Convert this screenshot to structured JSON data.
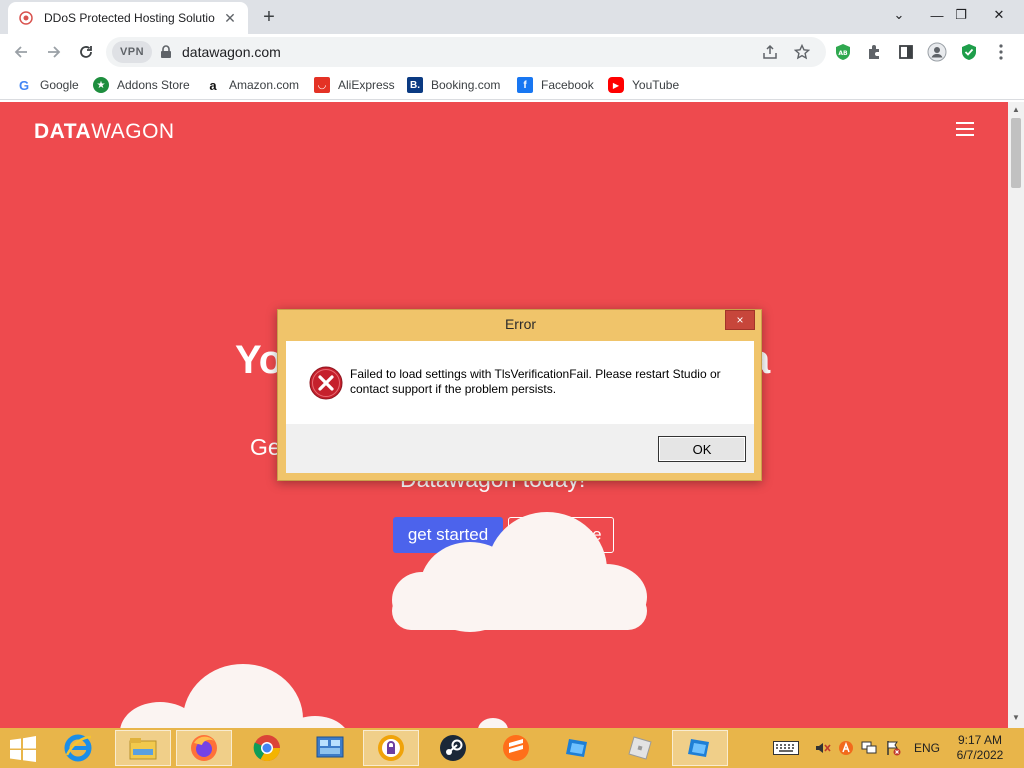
{
  "browser": {
    "tab": {
      "title": "DDoS Protected Hosting Solutio",
      "favicon": "ddos-favicon-icon"
    },
    "address": {
      "vpn_label": "VPN",
      "url": "datawagon.com"
    },
    "bookmarks": [
      {
        "label": "Google",
        "icon": "google-icon"
      },
      {
        "label": "Addons Store",
        "icon": "addons-store-icon"
      },
      {
        "label": "Amazon.com",
        "icon": "amazon-icon"
      },
      {
        "label": "AliExpress",
        "icon": "aliexpress-icon"
      },
      {
        "label": "Booking.com",
        "icon": "booking-icon"
      },
      {
        "label": "Facebook",
        "icon": "facebook-icon"
      },
      {
        "label": "YouTube",
        "icon": "youtube-icon"
      }
    ],
    "extension_badge": "AB"
  },
  "page": {
    "logo_bold": "DATA",
    "logo_light": "WAGON",
    "hero_title_left": "Yo",
    "hero_title_right": "a",
    "hero_sub_left": "Ge",
    "hero_sub_line2": "Datawagon today!",
    "cta_primary": "get started",
    "cta_secondary": "learn more",
    "accent_color": "#ee4a4e",
    "button_color": "#4c63ec"
  },
  "dialog": {
    "title": "Error",
    "close_label": "×",
    "message": "Failed to load settings with TlsVerificationFail. Please restart Studio or contact support if the problem persists.",
    "ok_label": "OK"
  },
  "taskbar": {
    "language": "ENG",
    "time": "9:17 AM",
    "date": "6/7/2022",
    "color": "#e8b54a"
  }
}
